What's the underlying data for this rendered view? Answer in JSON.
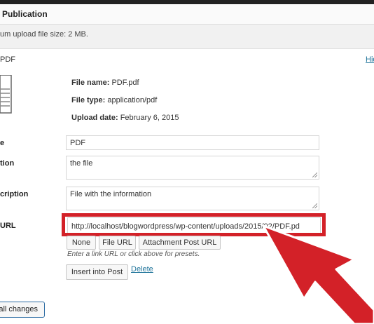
{
  "header": {
    "title": "Publication"
  },
  "max_upload_text": "um upload file size: 2 MB.",
  "panel": {
    "name_fragment": "PDF",
    "hide_link": "Hid"
  },
  "file_info": {
    "file_name_label": "File name:",
    "file_name": "PDF.pdf",
    "file_type_label": "File type:",
    "file_type": "application/pdf",
    "upload_date_label": "Upload date:",
    "upload_date": "February 6, 2015"
  },
  "fields": {
    "title_label": "e",
    "title_value": "PDF",
    "caption_label": "tion",
    "caption_value": "the file",
    "description_label": "cription",
    "description_value": "File with the information",
    "link_label": "URL",
    "link_value": "http://localhost/blogwordpress/wp-content/uploads/2015/02/PDF.pd"
  },
  "url_buttons": {
    "none": "None",
    "file_url": "File URL",
    "attachment_post_url": "Attachment Post URL"
  },
  "hint": "Enter a link URL or click above for presets.",
  "actions": {
    "insert": "Insert into Post",
    "delete": "Delete",
    "save": "all changes"
  },
  "colors": {
    "highlight": "#d32128",
    "link": "#21759b"
  }
}
